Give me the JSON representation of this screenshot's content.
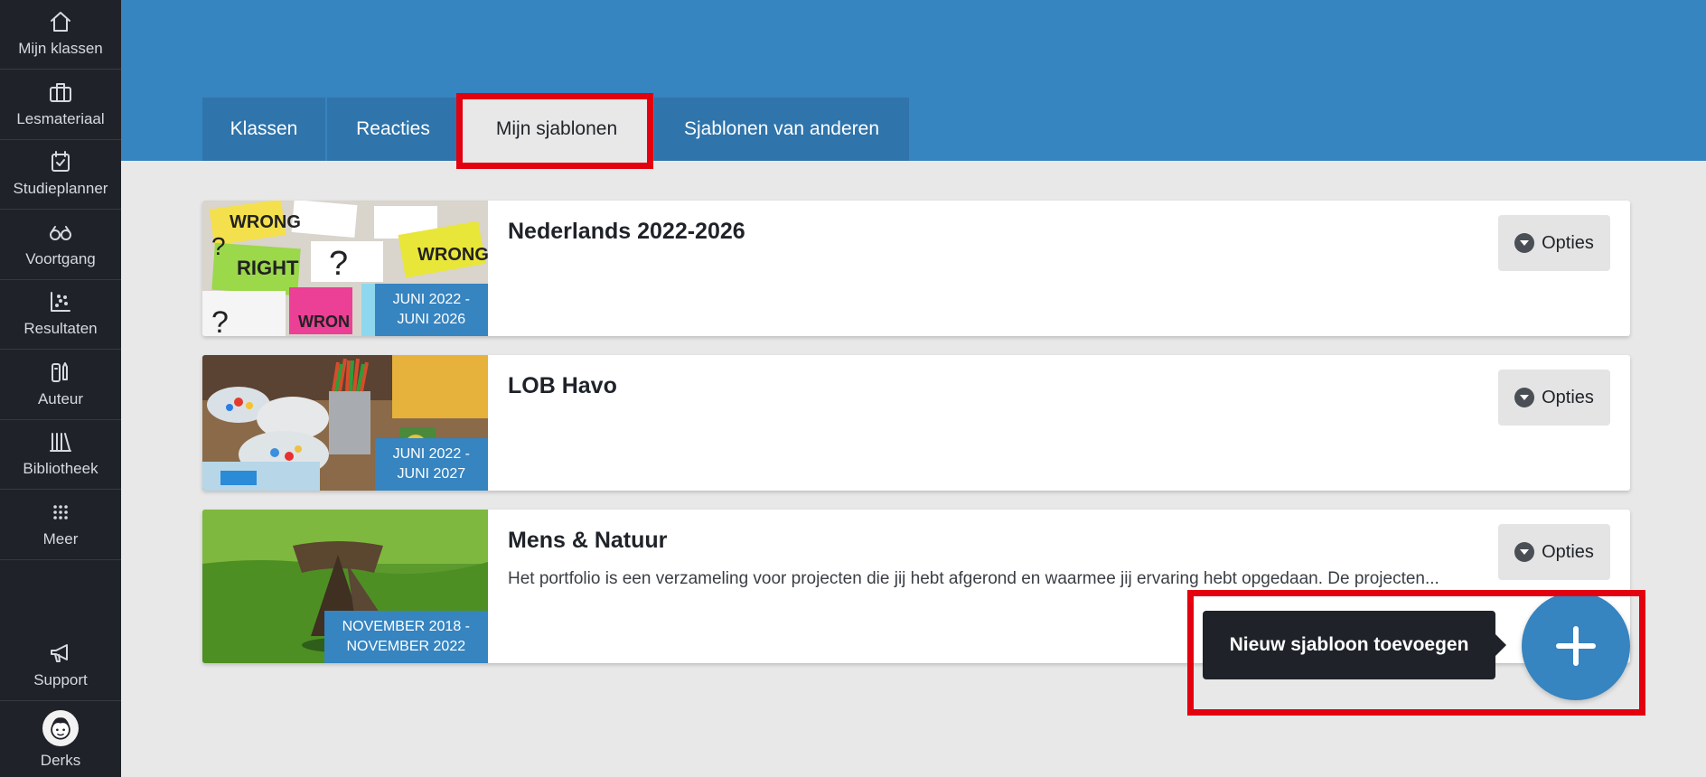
{
  "sidebar": {
    "items": [
      {
        "label": "Mijn klassen",
        "icon": "home-icon"
      },
      {
        "label": "Lesmateriaal",
        "icon": "briefcase-icon"
      },
      {
        "label": "Studieplanner",
        "icon": "calendar-check-icon"
      },
      {
        "label": "Voortgang",
        "icon": "glasses-icon"
      },
      {
        "label": "Resultaten",
        "icon": "scatter-chart-icon"
      },
      {
        "label": "Auteur",
        "icon": "pencil-book-icon"
      },
      {
        "label": "Bibliotheek",
        "icon": "books-icon"
      },
      {
        "label": "Meer",
        "icon": "grid-icon"
      }
    ],
    "support": {
      "label": "Support",
      "icon": "megaphone-icon"
    },
    "user": {
      "label": "Derks",
      "icon": "avatar-icon"
    }
  },
  "tabs": [
    {
      "label": "Klassen",
      "active": false
    },
    {
      "label": "Reacties",
      "active": false
    },
    {
      "label": "Mijn sjablonen",
      "active": true
    },
    {
      "label": "Sjablonen van anderen",
      "active": false
    }
  ],
  "templates": [
    {
      "title": "Nederlands 2022-2026",
      "date_line1": "JUNI 2022 -",
      "date_line2": "JUNI 2026",
      "description": "",
      "options_label": "Opties",
      "image": "sticky-notes-right-wrong"
    },
    {
      "title": "LOB Havo",
      "date_line1": "JUNI 2022 -",
      "date_line2": "JUNI 2027",
      "description": "",
      "options_label": "Opties",
      "image": "craft-supplies"
    },
    {
      "title": "Mens & Natuur",
      "date_line1": "NOVEMBER 2018 -",
      "date_line2": "NOVEMBER 2022",
      "description": "Het portfolio is een verzameling voor projecten die jij hebt afgerond en waarmee jij ervaring hebt opgedaan. De projecten...",
      "options_label": "Opties",
      "image": "owl-on-grass"
    }
  ],
  "add_template": {
    "tooltip": "Nieuw sjabloon toevoegen",
    "icon": "plus-icon"
  },
  "colors": {
    "sidebar": "#1f2329",
    "header": "#3684c0",
    "tab": "#2f74ab",
    "highlight": "#e3000f",
    "background": "#e8e8e8"
  }
}
